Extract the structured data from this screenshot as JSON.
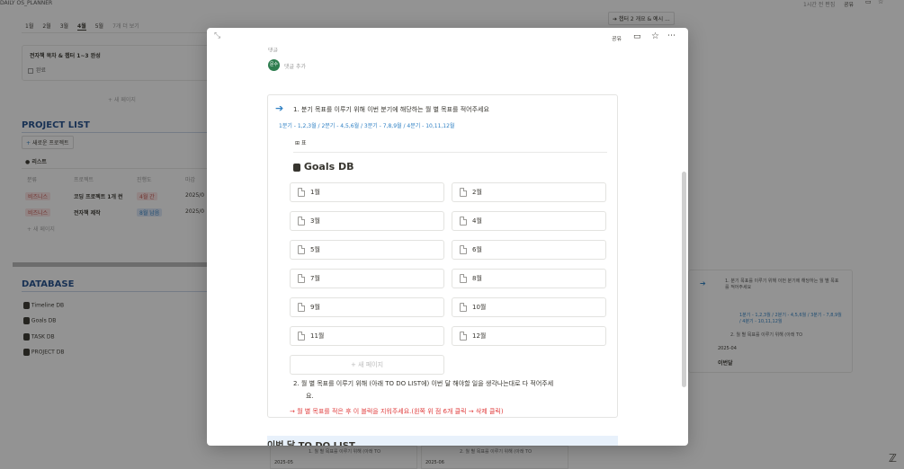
{
  "app": {
    "title": "DAILY OS_PLANNER",
    "edited": "1시간 전 편집",
    "share": "공유"
  },
  "top_tabs": {
    "items": [
      "1월",
      "2월",
      "3월",
      "4월",
      "5월"
    ],
    "more": "7개 더 보기"
  },
  "tasks": {
    "item_title": "전자책 목차 & 챕터 1~3 완성",
    "status": "완료",
    "new_page": "+ 새 페이지"
  },
  "project_list": {
    "title": "PROJECT LIST",
    "new_project": "새로운 프로젝트",
    "view_label": "리스트",
    "columns": [
      "분류",
      "프로젝트",
      "진행도",
      "마감"
    ],
    "rows": [
      {
        "category": "비즈니스",
        "project": "코딩 프로젝트 1개 런",
        "progress": "4월 간",
        "deadline": "2025/0"
      },
      {
        "category": "비즈니스",
        "project": "전자책 제작",
        "progress": "8월 남음",
        "deadline": "2025/0"
      }
    ],
    "new_page": "+ 새 페이지"
  },
  "database": {
    "title": "DATABASE",
    "items": [
      "Timeline DB",
      "Goals DB",
      "TASK DB",
      "PROJECT DB"
    ]
  },
  "right_bg": {
    "chapter": "➔ 챕터 2 개요 & 예시 ...",
    "card_text1": "1. 분기 목표를 이루기 위해 이번 분기에 해당하는 월 별 목표를 적어주세요",
    "card_text2": "1분기 - 1,2,3월 / 2분기 - 4,5,6월 / 3분기 - 7,8,9월 / 4분기 - 10,11,12월",
    "card_text3": "2. 월 별 목표를 이루기 위해 (아래 TO",
    "card_date": "2025-04",
    "card_name": "이번달"
  },
  "bottom_bg": {
    "text1": "1. 월 별 목표를 이루기 위해 (아래 TO",
    "text2": "2. 월 별 목표를 이루기 위해 (아래 TO",
    "date1": "2025-05",
    "date2": "2025-06"
  },
  "modal": {
    "toolbar": {
      "share": "공유"
    },
    "top_cut": "댓글",
    "comment_placeholder": "댓글 추가",
    "avatar_initials": "문수",
    "step1": "1.  분기 목표를 이루기 위해 이번 분기에 해당하는 월 별 목표를 적어주세요",
    "step1_sub": "1분기 - 1,2,3월 / 2분기 - 4,5,6월 / 3분기 - 7,8,9월 / 4분기 - 10,11,12월",
    "view_label": "표",
    "db_title": "Goals DB",
    "months": [
      "1월",
      "2월",
      "3월",
      "4월",
      "5월",
      "6월",
      "7월",
      "8월",
      "9월",
      "10월",
      "11월",
      "12월"
    ],
    "new_page": "+ 새 페이지",
    "step2_a": "2.  월 별 목표를 이루기 위해 (아래 TO DO LIST에) 이번 달 해야할 일을 생각나는대로 다 적어주세",
    "step2_b": "요.",
    "warning": "→ 월 별 목표를 적은 후 이 블럭을 지워주세요.(왼쪽 위 점 6개 클릭 → 삭제 클릭)",
    "section_title": "이번 달 TO DO LIST"
  },
  "colors": {
    "accent": "#2f80c4",
    "warn": "#e03e3e",
    "tag_red": "#fbe4e4",
    "tag_blue": "#dde8f8"
  }
}
